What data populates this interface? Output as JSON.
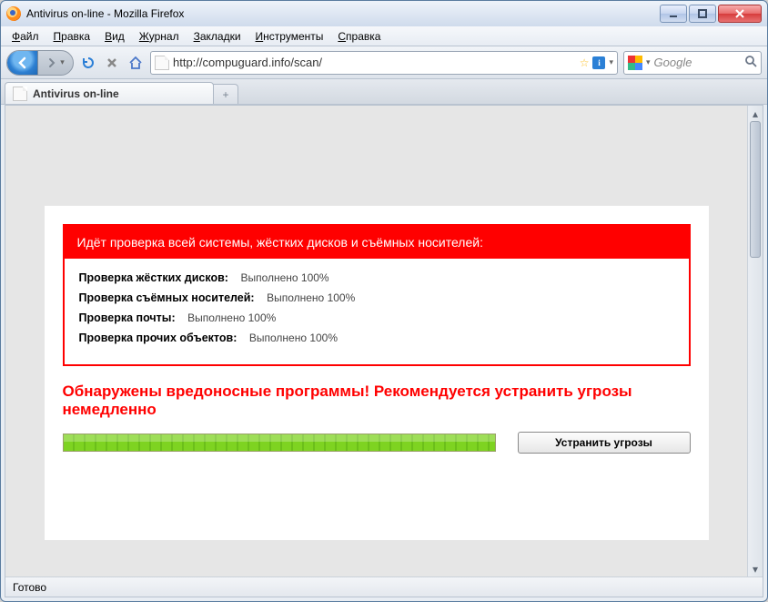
{
  "window": {
    "title": "Antivirus on-line - Mozilla Firefox"
  },
  "menu": {
    "items": [
      {
        "accel": "Ф",
        "rest": "айл"
      },
      {
        "accel": "П",
        "rest": "равка"
      },
      {
        "accel": "В",
        "rest": "ид"
      },
      {
        "accel": "Ж",
        "rest": "урнал"
      },
      {
        "accel": "З",
        "rest": "акладки"
      },
      {
        "accel": "И",
        "rest": "нструменты"
      },
      {
        "accel": "С",
        "rest": "правка"
      }
    ]
  },
  "toolbar": {
    "url": "http://compuguard.info/scan/",
    "search_placeholder": "Google"
  },
  "tabs": {
    "active_label": "Antivirus on-line"
  },
  "page": {
    "header": "Идёт проверка всей системы, жёстких дисков и съёмных носителей:",
    "rows": [
      {
        "label": "Проверка жёстких дисков:",
        "value": "Выполнено 100%"
      },
      {
        "label": "Проверка съёмных носителей:",
        "value": "Выполнено 100%"
      },
      {
        "label": "Проверка почты:",
        "value": "Выполнено 100%"
      },
      {
        "label": "Проверка прочих объектов:",
        "value": "Выполнено 100%"
      }
    ],
    "warning": "Обнаружены вредоносные программы! Рекомендуется устранить угрозы немедленно",
    "button": "Устранить угрозы"
  },
  "status": {
    "text": "Готово"
  }
}
